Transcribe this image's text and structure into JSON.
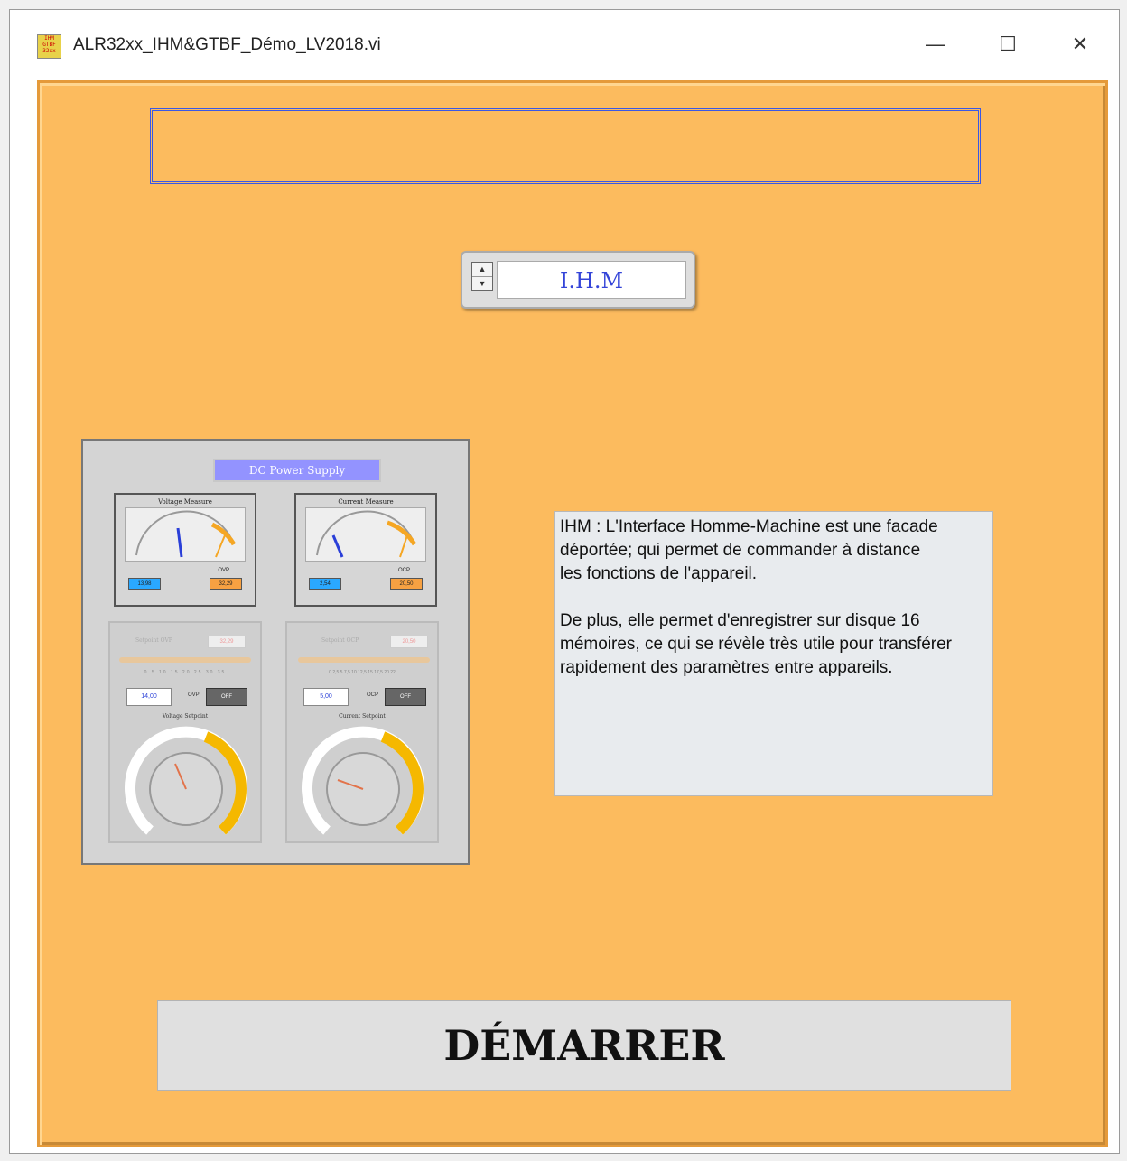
{
  "window": {
    "title": "ALR32xx_IHM&GTBF_Démo_LV2018.vi",
    "icon_text": "IHM GTBF 32xx",
    "minimize_symbol": "—",
    "maximize_symbol": "☐",
    "close_symbol": "✕"
  },
  "panel": {
    "string_indicator": "",
    "ring": {
      "value": "I.H.M",
      "up_glyph": "▲",
      "down_glyph": "▼"
    },
    "preview": {
      "title": "DC Power Supply",
      "voltage_meter": {
        "label": "Voltage Measure",
        "readout": "13,98",
        "limit_label": "OVP",
        "limit_value": "32,29"
      },
      "current_meter": {
        "label": "Current Measure",
        "readout": "2,54",
        "limit_label": "OCP",
        "limit_value": "20,50"
      },
      "voltage_setpoint": {
        "limit_label": "Setpoint OVP",
        "limit_value": "32,29",
        "value": "14,00",
        "switch_label": "OVP",
        "switch_state": "OFF",
        "knob_label": "Voltage Setpoint",
        "scale": "0 5 10 15 20 25 30 35"
      },
      "current_setpoint": {
        "limit_label": "Setpoint OCP",
        "limit_value": "20,50",
        "value": "5,00",
        "switch_label": "OCP",
        "switch_state": "OFF",
        "knob_label": "Current Setpoint",
        "scale": "0 2,5 5 7,5 10 12,5 15 17,5 20 22"
      }
    },
    "info": {
      "paragraph1": "IHM : L'Interface Homme-Machine est une facade\ndéportée; qui permet de commander à distance\nles fonctions de l'appareil.",
      "paragraph2": "De plus, elle permet d'enregistrer sur disque 16\nmémoires, ce qui se révèle très utile pour transférer\nrapidement des paramètres entre appareils."
    },
    "start_button": "DÉMARRER"
  },
  "colors": {
    "panel": "#fcbb5e",
    "accent_blue": "#3444d8",
    "info_bg": "#e8ebee"
  }
}
